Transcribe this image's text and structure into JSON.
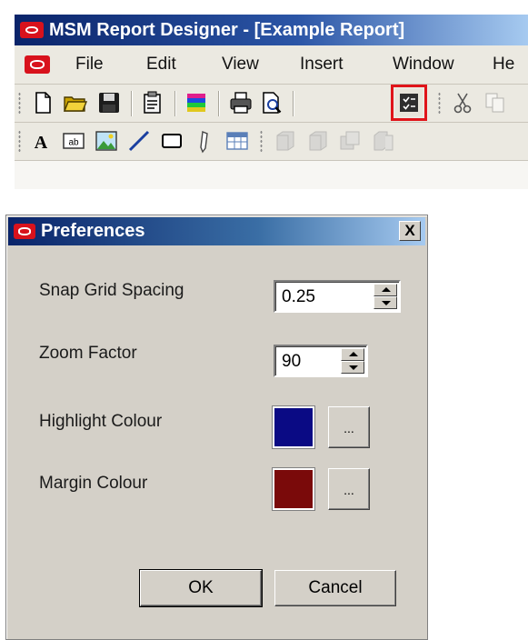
{
  "app": {
    "title": "MSM Report Designer - [Example Report]",
    "menu": [
      "File",
      "Edit",
      "View",
      "Insert",
      "Window",
      "He"
    ]
  },
  "toolbar_standard": {
    "buttons": [
      "new-icon",
      "open-folder-icon",
      "save-icon",
      "report-properties-icon",
      "color-palette-icon",
      "print-icon",
      "print-preview-icon",
      "preferences-icon",
      "cut-icon",
      "copy-icon"
    ],
    "highlighted": "preferences-icon"
  },
  "toolbar_drawing": {
    "buttons": [
      "text-icon",
      "textbox-icon",
      "image-icon",
      "line-icon",
      "rectangle-icon",
      "pen-icon",
      "table-icon",
      "align-1-icon",
      "align-2-icon",
      "align-3-icon",
      "align-4-icon"
    ]
  },
  "dialog": {
    "title": "Preferences",
    "close_label": "X",
    "snap_grid_label": "Snap Grid Spacing",
    "snap_grid_value": "0.25",
    "zoom_label": "Zoom Factor",
    "zoom_value": "90",
    "highlight_label": "Highlight Colour",
    "highlight_color": "#0a0a84",
    "margin_label": "Margin Colour",
    "margin_color": "#7a0a0a",
    "browse_label": "...",
    "ok_label": "OK",
    "cancel_label": "Cancel"
  },
  "colors": {
    "title_bar": "#0a246a",
    "oracle_red": "#d8121c",
    "highlight_box": "#e0141a",
    "dialog_face": "#d4d0c8"
  }
}
